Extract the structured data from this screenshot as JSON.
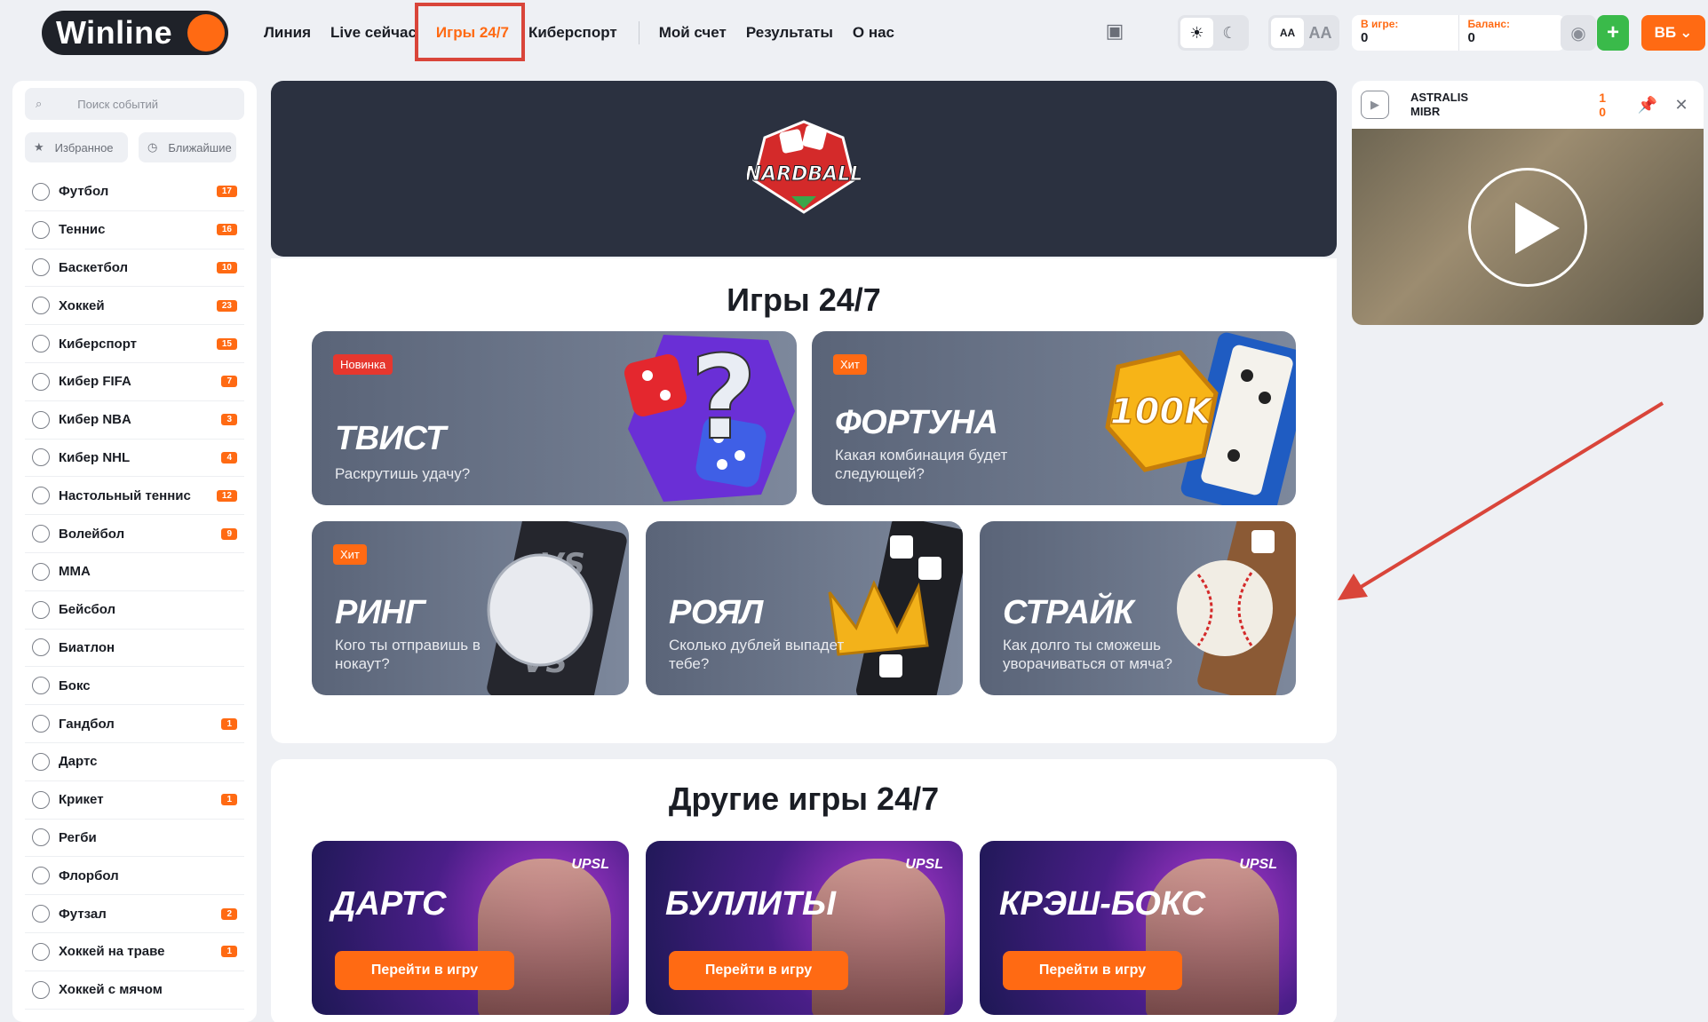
{
  "brand": {
    "name": "Winline"
  },
  "nav": [
    "Линия",
    "Live сейчас",
    "Игры 24/7",
    "Киберспорт",
    "Мой счет",
    "Результаты",
    "О нас"
  ],
  "header": {
    "in_game_label": "В игре:",
    "in_game_value": "0",
    "balance_label": "Баланс:",
    "balance_value": "0",
    "user_initials": "ВБ",
    "font_small": "AA",
    "font_big": "AA"
  },
  "sidebar": {
    "search_placeholder": "Поиск событий",
    "favorites": "Избранное",
    "nearest": "Ближайшие",
    "sports": [
      {
        "name": "Футбол",
        "count": "17"
      },
      {
        "name": "Теннис",
        "count": "16"
      },
      {
        "name": "Баскетбол",
        "count": "10"
      },
      {
        "name": "Хоккей",
        "count": "23"
      },
      {
        "name": "Киберспорт",
        "count": "15"
      },
      {
        "name": "Кибер FIFA",
        "count": "7"
      },
      {
        "name": "Кибер NBA",
        "count": "3"
      },
      {
        "name": "Кибер NHL",
        "count": "4"
      },
      {
        "name": "Настольный теннис",
        "count": "12"
      },
      {
        "name": "Волейбол",
        "count": "9"
      },
      {
        "name": "MMA",
        "count": ""
      },
      {
        "name": "Бейсбол",
        "count": ""
      },
      {
        "name": "Биатлон",
        "count": ""
      },
      {
        "name": "Бокс",
        "count": ""
      },
      {
        "name": "Гандбол",
        "count": "1"
      },
      {
        "name": "Дартс",
        "count": ""
      },
      {
        "name": "Крикет",
        "count": "1"
      },
      {
        "name": "Регби",
        "count": ""
      },
      {
        "name": "Флорбол",
        "count": ""
      },
      {
        "name": "Футзал",
        "count": "2"
      },
      {
        "name": "Хоккей на траве",
        "count": "1"
      },
      {
        "name": "Хоккей с мячом",
        "count": ""
      }
    ]
  },
  "main": {
    "banner_logo": "NARDBALL",
    "section_title": "Игры 24/7",
    "games": [
      {
        "title": "ТВИСТ",
        "subtitle": "Раскрутишь удачу?",
        "badge": "Новинка"
      },
      {
        "title": "ФОРТУНА",
        "subtitle": "Какая комбинация будет следующей?",
        "badge": "Хит",
        "art_text": "100K"
      },
      {
        "title": "РИНГ",
        "subtitle": "Кого ты отправишь в нокаут?",
        "badge": "Хит"
      },
      {
        "title": "РОЯЛ",
        "subtitle": "Сколько дублей выпадет тебе?",
        "badge": ""
      },
      {
        "title": "СТРАЙК",
        "subtitle": "Как долго ты сможешь уворачиваться от мяча?",
        "badge": ""
      }
    ],
    "other_title": "Другие игры 24/7",
    "other_games": [
      {
        "title": "ДАРТС",
        "button": "Перейти в игру",
        "brand": "UPSL"
      },
      {
        "title": "БУЛЛИТЫ",
        "button": "Перейти в игру",
        "brand": "UPSL"
      },
      {
        "title": "КРЭШ-БОКС",
        "button": "Перейти в игру",
        "brand": "UPSL"
      }
    ]
  },
  "stream": {
    "team1": "ASTRALIS",
    "team2": "MIBR",
    "score1": "1",
    "score2": "0"
  },
  "colors": {
    "accent": "#ff6a13",
    "highlight_box": "#d9453a",
    "success": "#3aba4a"
  }
}
